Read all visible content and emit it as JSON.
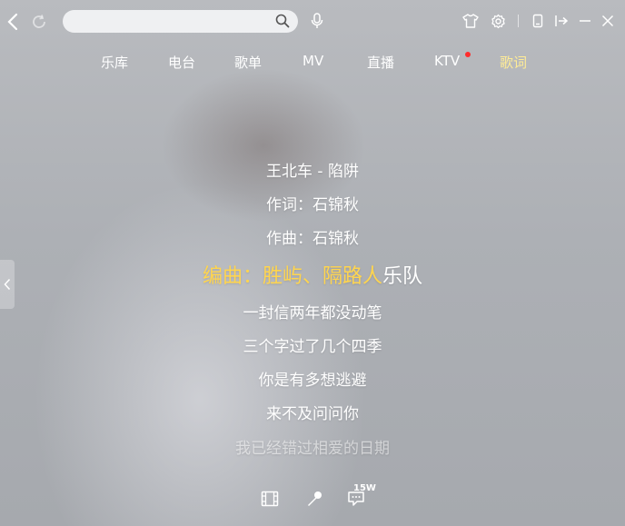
{
  "search": {
    "value": "",
    "placeholder": ""
  },
  "nav": {
    "tabs": [
      {
        "label": "乐库"
      },
      {
        "label": "电台"
      },
      {
        "label": "歌单"
      },
      {
        "label": "MV"
      },
      {
        "label": "直播"
      },
      {
        "label": "KTV"
      },
      {
        "label": "歌词"
      }
    ],
    "active": "歌词"
  },
  "lyrics": {
    "lines": [
      "王北车 - 陷阱",
      "作词：石锦秋",
      "作曲：石锦秋",
      "",
      "一封信两年都没动笔",
      "三个字过了几个四季",
      "你是有多想逃避",
      "来不及问问你",
      "我已经错过相爱的日期"
    ],
    "current_sung": "编曲：胜屿、隔路人",
    "current_rest": "乐队"
  },
  "actions": {
    "comment_count": "15W"
  },
  "colors": {
    "accent": "#ffd54f",
    "active_tab": "#ffec96",
    "notify_dot": "#ff2c2c"
  },
  "icons": [
    "back-icon",
    "refresh-icon",
    "search-icon",
    "microphone-search-icon",
    "skin-icon",
    "settings-icon",
    "mini-mode-icon",
    "exit-icon",
    "minimize-icon",
    "close-icon",
    "collapse-handle-icon",
    "video-icon",
    "karaoke-mic-icon",
    "comment-icon"
  ]
}
